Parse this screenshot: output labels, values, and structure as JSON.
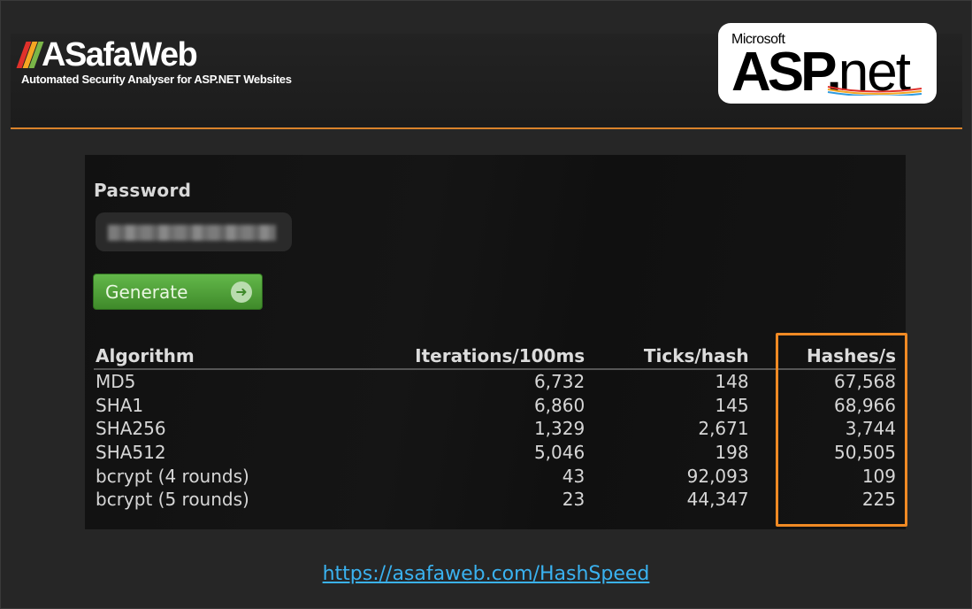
{
  "brand": {
    "name": "ASafaWeb",
    "tagline": "Automated Security Analyser for ASP.NET Websites",
    "stripe_colors": [
      "#e0312b",
      "#f5a623",
      "#7ab648"
    ]
  },
  "partner_logo": {
    "small_text": "Microsoft",
    "big_text": "ASP",
    "dot": ".",
    "net_text": "net"
  },
  "form": {
    "password_label": "Password",
    "password_value": "",
    "generate_label": "Generate",
    "generate_icon": "arrow-right-circle-icon"
  },
  "table": {
    "headers": [
      "Algorithm",
      "Iterations/100ms",
      "Ticks/hash",
      "Hashes/s"
    ],
    "rows": [
      [
        "MD5",
        "6,732",
        "148",
        "67,568"
      ],
      [
        "SHA1",
        "6,860",
        "145",
        "68,966"
      ],
      [
        "SHA256",
        "1,329",
        "2,671",
        "3,744"
      ],
      [
        "SHA512",
        "5,046",
        "198",
        "50,505"
      ],
      [
        "bcrypt (4 rounds)",
        "43",
        "92,093",
        "109"
      ],
      [
        "bcrypt (5 rounds)",
        "23",
        "44,347",
        "225"
      ]
    ]
  },
  "footer": {
    "link": "https://asafaweb.com/HashSpeed"
  },
  "colors": {
    "accent": "#d9822b",
    "highlight": "#f08a24",
    "button": "#4fa036",
    "link": "#3ab2f0"
  }
}
